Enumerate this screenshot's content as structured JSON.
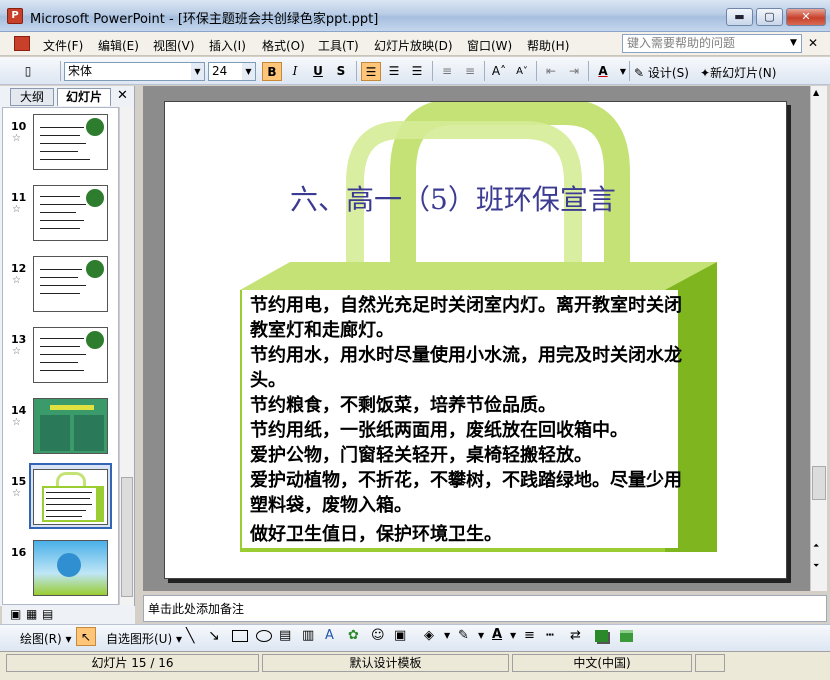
{
  "window": {
    "title": "Microsoft PowerPoint - [环保主题班会共创绿色家ppt.ppt]",
    "app_icon_label": "P",
    "minimize": "▬",
    "maximize": "▢",
    "close": "✕"
  },
  "menu": {
    "items": [
      "文件(F)",
      "编辑(E)",
      "视图(V)",
      "插入(I)",
      "格式(O)",
      "工具(T)",
      "幻灯片放映(D)",
      "窗口(W)",
      "帮助(H)"
    ],
    "help_placeholder": "键入需要帮助的问题"
  },
  "toolbar": {
    "font_name": "宋体",
    "font_size": "24",
    "bold": "B",
    "italic": "I",
    "underline": "U",
    "shadow": "S",
    "design_label": "设计(S)",
    "new_slide_label": "新幻灯片(N)"
  },
  "left_pane": {
    "tabs": [
      "大纲",
      "幻灯片"
    ],
    "close": "✕",
    "slide_numbers": [
      "10",
      "11",
      "12",
      "13",
      "14",
      "15",
      "16"
    ],
    "selected_slide": "15"
  },
  "slide": {
    "title": "六、高一（5）班环保宣言",
    "body_lines": [
      "节约用电，自然光充足时关闭室内灯。离开教室时关闭教室灯和走廊灯。",
      "节约用水，用水时尽量使用小水流，用完及时关闭水龙头。",
      "节约粮食，不剩饭菜，培养节俭品质。",
      "节约用纸，一张纸两面用，废纸放在回收箱中。",
      "爱护公物，门窗轻关轻开，桌椅轻搬轻放。",
      "爱护动植物，不折花，不攀树，不践踏绿地。尽量少用塑料袋，废物入箱。",
      "做好卫生值日，保护环境卫生。"
    ],
    "bag_color": "#9acd32",
    "bag_light_color": "#c4e276"
  },
  "notes": {
    "placeholder": "单击此处添加备注"
  },
  "drawing_toolbar": {
    "draw_label": "绘图(R)",
    "autoshapes_label": "自选图形(U)"
  },
  "status": {
    "slide_info": "幻灯片 15 / 16",
    "template": "默认设计模板",
    "language": "中文(中国)"
  }
}
